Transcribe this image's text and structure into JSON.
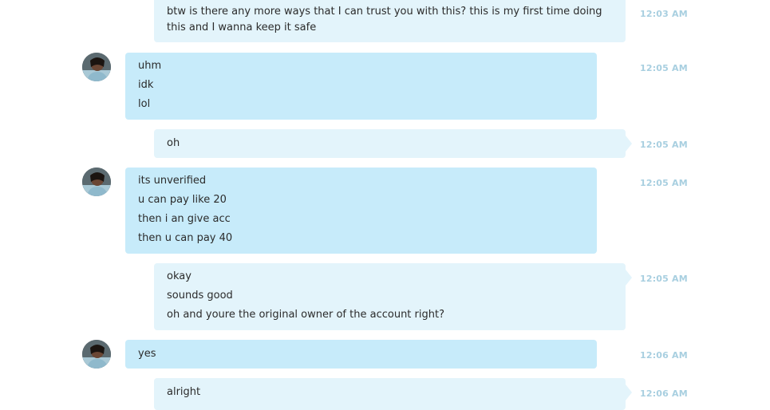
{
  "messages": [
    {
      "direction": "out",
      "time": "12:03 AM",
      "lines": [
        "btw is there any more ways that I can trust you with this? this is my first time doing this and I wanna keep it safe"
      ]
    },
    {
      "direction": "in",
      "time": "12:05 AM",
      "lines": [
        "uhm",
        "idk",
        "lol"
      ]
    },
    {
      "direction": "out",
      "time": "12:05 AM",
      "lines": [
        "oh"
      ]
    },
    {
      "direction": "in",
      "time": "12:05 AM",
      "lines": [
        "its unverified",
        "u can pay like 20",
        "then i an give acc",
        "then u can pay 40"
      ]
    },
    {
      "direction": "out",
      "time": "12:05 AM",
      "lines": [
        "okay",
        "sounds good",
        "oh and youre the original owner of the account right?"
      ]
    },
    {
      "direction": "in",
      "time": "12:06 AM",
      "lines": [
        "yes"
      ]
    },
    {
      "direction": "out",
      "time": "12:06 AM",
      "lines": [
        "alright"
      ]
    }
  ],
  "colors": {
    "incoming_bubble": "#c7ebfa",
    "outgoing_bubble": "#e3f4fb",
    "timestamp": "#a8cfe0"
  },
  "icons": {
    "avatar": "contact-avatar-icon"
  }
}
